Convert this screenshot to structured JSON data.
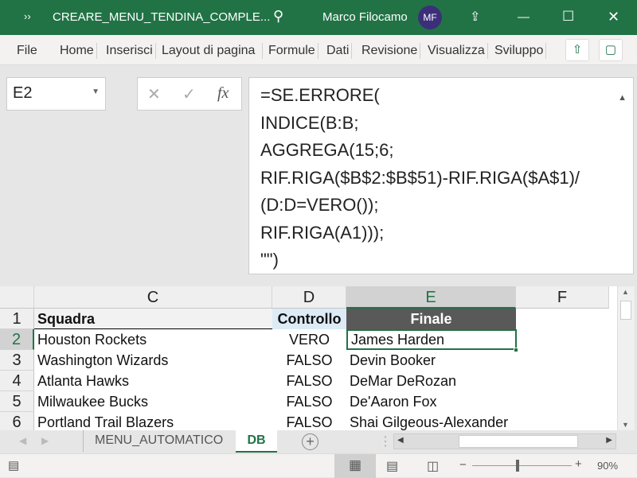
{
  "window": {
    "title": "CREARE_MENU_TENDINA_COMPLE...",
    "user": "Marco Filocamo",
    "initials": "MF",
    "accent": "#217346"
  },
  "ribbon": {
    "tabs": [
      "File",
      "Home",
      "Inserisci",
      "Layout di pagina",
      "Formule",
      "Dati",
      "Revisione",
      "Visualizza",
      "Sviluppo"
    ]
  },
  "formula_bar": {
    "name_box": "E2",
    "fx": "fx",
    "lines": [
      "=SE.ERRORE(",
      "INDICE(B:B;",
      "AGGREGA(15;6;",
      "RIF.RIGA($B$2:$B$51)-RIF.RIGA($A$1)/",
      "(D:D=VERO());",
      "RIF.RIGA(A1)));",
      "\"\")"
    ]
  },
  "sheet": {
    "columns": [
      "C",
      "D",
      "E",
      "F"
    ],
    "rows": [
      "1",
      "2",
      "3",
      "4",
      "5",
      "6"
    ],
    "header": [
      "Squadra",
      "Controllo",
      "Finale"
    ],
    "data": [
      [
        "Houston Rockets",
        "VERO",
        "James Harden"
      ],
      [
        "Washington Wizards",
        "FALSO",
        "Devin Booker"
      ],
      [
        "Atlanta Hawks",
        "FALSO",
        "DeMar DeRozan"
      ],
      [
        "Milwaukee Bucks",
        "FALSO",
        "De'Aaron Fox"
      ],
      [
        "Portland Trail Blazers",
        "FALSO",
        "Shai Gilgeous-Alexander"
      ]
    ]
  },
  "sheet_tabs": {
    "tabs": [
      "MENU_AUTOMATICO",
      "DB"
    ],
    "active": "DB"
  },
  "status": {
    "zoom": "90%"
  }
}
